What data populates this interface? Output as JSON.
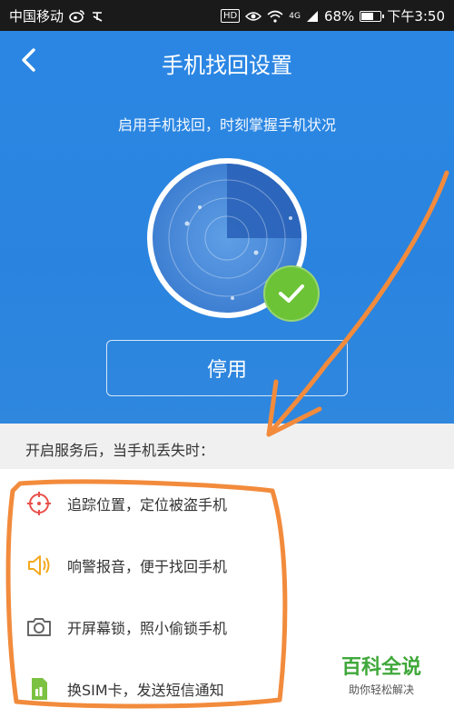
{
  "status_bar": {
    "carrier": "中国移动",
    "network": "4G",
    "battery": "68%",
    "battery_level": 0.68,
    "time": "下午3:50",
    "hd_badge": "HD"
  },
  "header": {
    "title": "手机找回设置"
  },
  "hero": {
    "subtitle": "启用手机找回，时刻掌握手机状况",
    "disable_button": "停用"
  },
  "section": {
    "heading": "开启服务后，当手机丢失时："
  },
  "features": [
    {
      "label": "追踪位置，定位被盗手机",
      "icon": "crosshair-icon",
      "color": "#e8504a"
    },
    {
      "label": "响警报音，便于找回手机",
      "icon": "speaker-icon",
      "color": "#f3a81d"
    },
    {
      "label": "开屏幕锁，照小偷锁手机",
      "icon": "camera-icon",
      "color": "#666666"
    },
    {
      "label": "换SIM卡，发送短信通知",
      "icon": "sim-card-icon",
      "color": "#7cc242"
    }
  ],
  "watermark": {
    "title": "百科全说",
    "subtitle": "助你轻松解决"
  },
  "colors": {
    "primary": "#2b86e3",
    "success": "#6cc336",
    "annotation": "#f28b3c"
  }
}
